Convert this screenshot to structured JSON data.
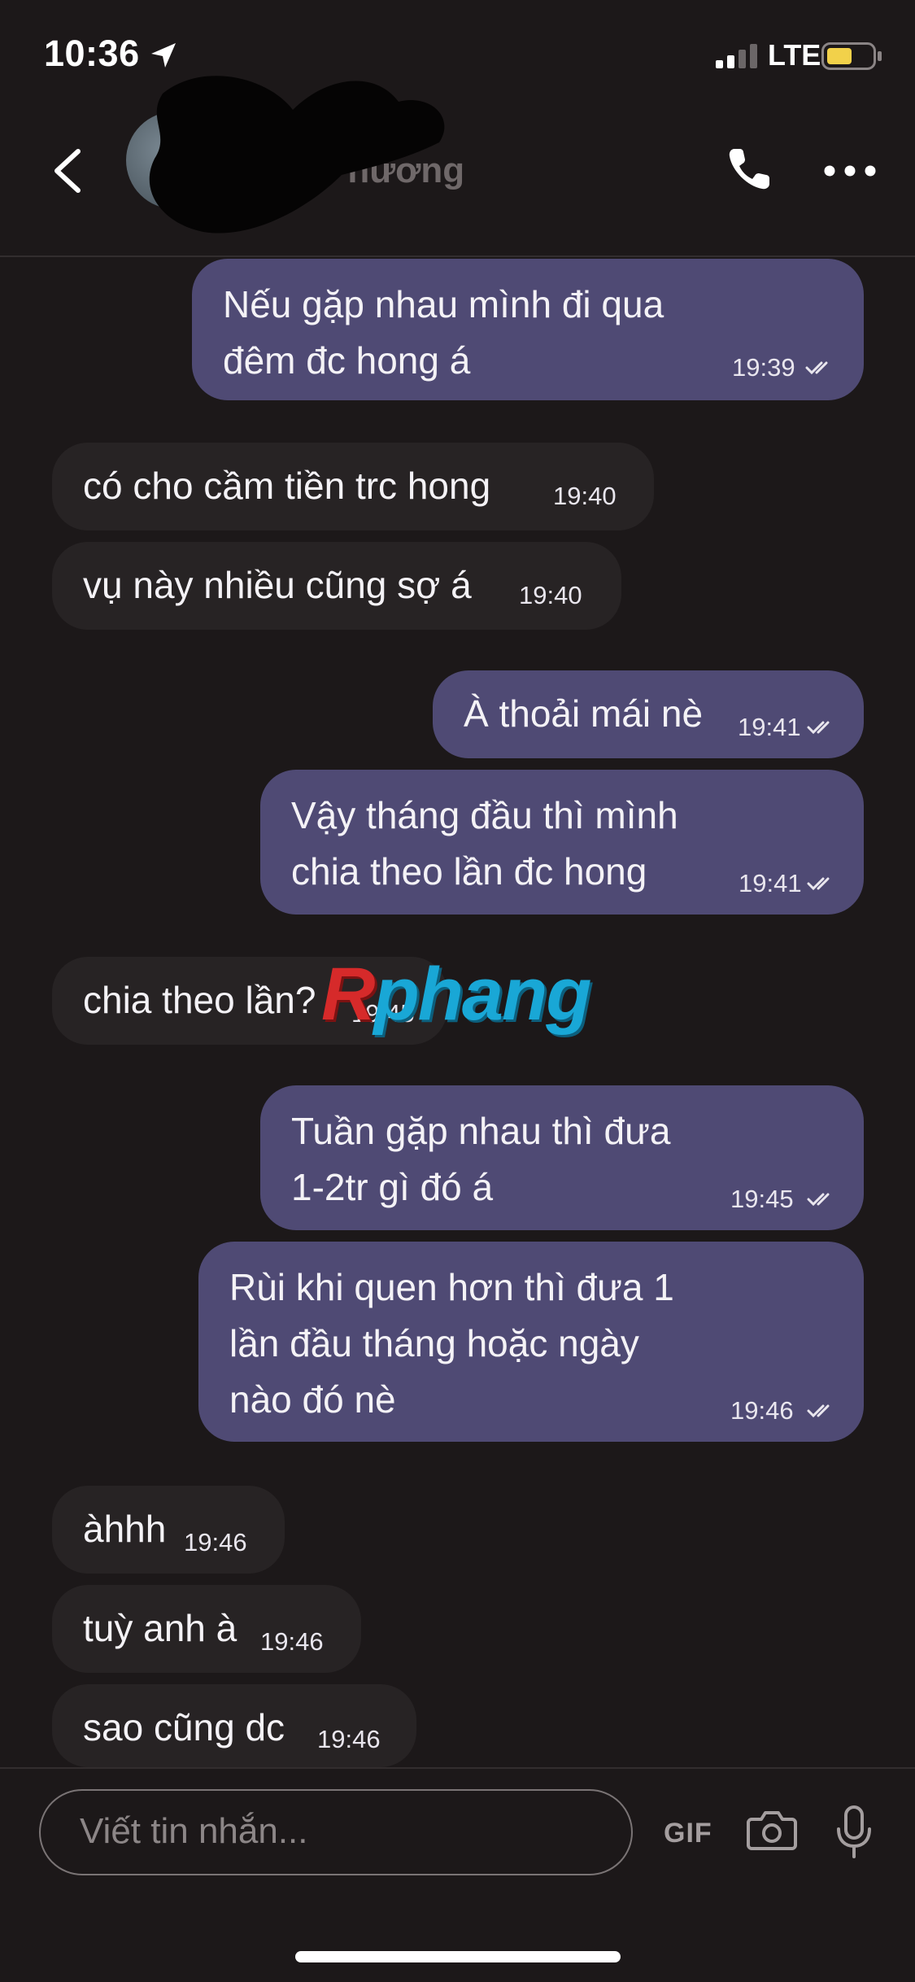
{
  "status_bar": {
    "time": "10:36",
    "network": "LTE",
    "battery_color": "#f2d14a"
  },
  "header": {
    "contact_name": "Phương"
  },
  "messages": [
    {
      "dir": "out",
      "text": "Nếu gặp nhau mình đi qua\nđêm đc hong á",
      "time": "19:39",
      "read": true
    },
    {
      "dir": "in",
      "text": "có cho cầm tiền trc hong",
      "time": "19:40"
    },
    {
      "dir": "in",
      "text": "vụ này nhiều cũng sợ á",
      "time": "19:40"
    },
    {
      "dir": "out",
      "text": "À thoải mái nè",
      "time": "19:41",
      "read": true
    },
    {
      "dir": "out",
      "text": "Vậy tháng đầu thì mình\nchia theo lần đc hong",
      "time": "19:41",
      "read": true
    },
    {
      "dir": "in",
      "text": "chia theo lần?",
      "time": "19:45"
    },
    {
      "dir": "out",
      "text": "Tuần gặp nhau thì đưa\n1-2tr gì đó á",
      "time": "19:45",
      "read": true
    },
    {
      "dir": "out",
      "text": "Rùi khi quen hơn thì đưa 1\nlần đầu tháng hoặc ngày\nnào đó nè",
      "time": "19:46",
      "read": true
    },
    {
      "dir": "in",
      "text": "àhhh",
      "time": "19:46"
    },
    {
      "dir": "in",
      "text": "tuỳ anh à",
      "time": "19:46"
    },
    {
      "dir": "in",
      "text": "sao cũng dc",
      "time": "19:46"
    }
  ],
  "watermark": {
    "first": "R",
    "rest": "phang"
  },
  "composer": {
    "placeholder": "Viết tin nhắn...",
    "gif_label": "GIF"
  },
  "colors": {
    "background": "#1c1819",
    "outgoing_bubble": "#4f4a74",
    "incoming_bubble": "#272324"
  }
}
